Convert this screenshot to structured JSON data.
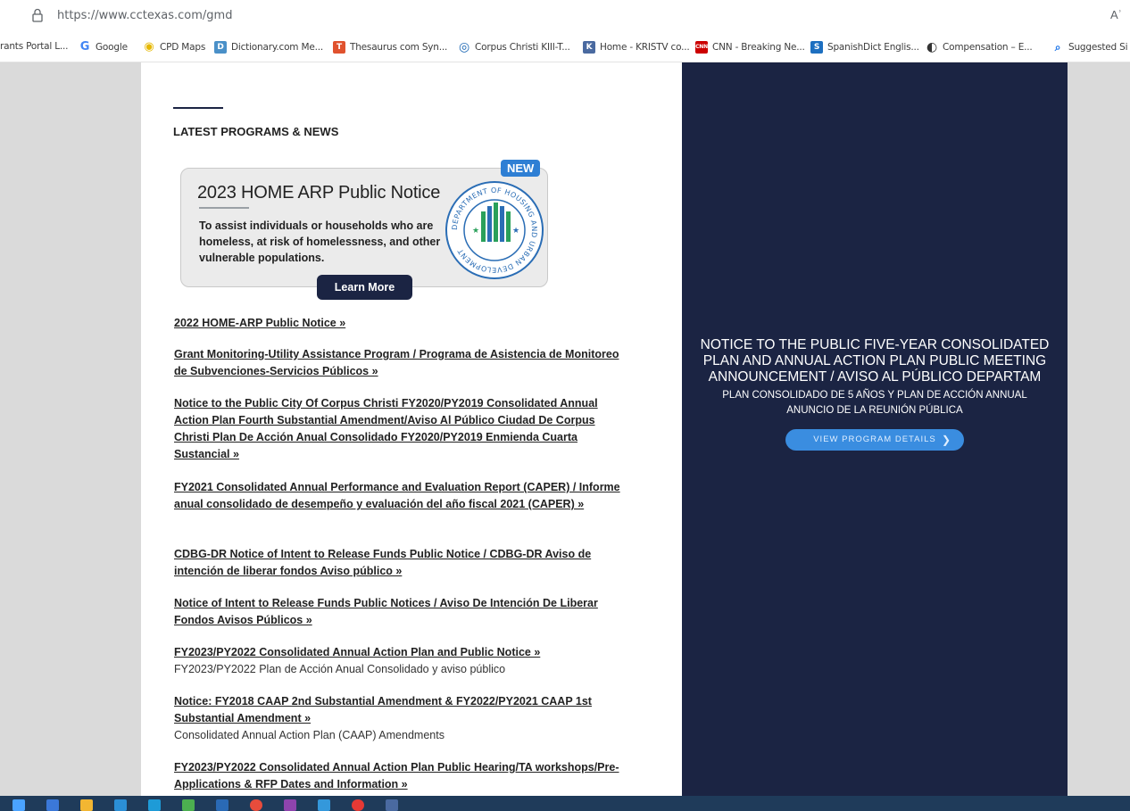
{
  "browser": {
    "url": "https://www.cctexas.com/gmd",
    "reader_icon": "Aʾ"
  },
  "bookmarks": [
    {
      "label": "rants Portal L...",
      "icon": "",
      "color": ""
    },
    {
      "label": "Google",
      "icon": "G",
      "color": "#4285f4"
    },
    {
      "label": "CPD Maps",
      "icon": "◉",
      "color": "#e6b800"
    },
    {
      "label": "Dictionary.com Me...",
      "icon": "D",
      "color": "#4a90c8"
    },
    {
      "label": "Thesaurus com Syn...",
      "icon": "T",
      "color": "#e0522e"
    },
    {
      "label": "Corpus Christi KIII-T...",
      "icon": "◎",
      "color": "#1a66b3"
    },
    {
      "label": "Home - KRISTV co...",
      "icon": "K",
      "color": "#4a6aa0"
    },
    {
      "label": "CNN - Breaking Ne...",
      "icon": "CNN",
      "color": "#cc0000"
    },
    {
      "label": "SpanishDict Englis...",
      "icon": "S",
      "color": "#1d6fc0"
    },
    {
      "label": "Compensation – E...",
      "icon": "◐",
      "color": "#333333"
    },
    {
      "label": "Suggested Si",
      "icon": "⌕",
      "color": "#1a73e8"
    }
  ],
  "section": {
    "title": "LATEST PROGRAMS & NEWS"
  },
  "card": {
    "badge": "NEW",
    "title": "2023 HOME ARP Public Notice",
    "description": "To assist individuals or households who are homeless, at risk of homelessness, and other vulnerable populations.",
    "button": "Learn More"
  },
  "news": [
    {
      "link": "2022 HOME-ARP Public Notice »",
      "sub": ""
    },
    {
      "link": "Grant Monitoring-Utility Assistance Program / Programa de Asistencia de Monitoreo de Subvenciones-Servicios Públicos »",
      "sub": ""
    },
    {
      "link": "Notice to the Public City Of Corpus Christi FY2020/PY2019 Consolidated Annual Action Plan Fourth Substantial Amendment/Aviso Al Público Ciudad De Corpus Christi Plan De Acción Anual Consolidado FY2020/PY2019 Enmienda Cuarta Sustancial »",
      "sub": ""
    },
    {
      "link": "FY2021 Consolidated Annual Performance and Evaluation Report (CAPER) / Informe anual consolidado de desempeño y evaluación del año fiscal 2021 (CAPER) »",
      "sub": ""
    },
    {
      "link": "CDBG-DR Notice of Intent to Release Funds Public Notice / CDBG-DR Aviso de intención de liberar fondos Aviso público »",
      "sub": ""
    },
    {
      "link": "Notice of Intent to Release Funds Public Notices / Aviso De Intención De Liberar Fondos Avisos Públicos »",
      "sub": ""
    },
    {
      "link": "FY2023/PY2022 Consolidated Annual Action Plan and Public Notice »",
      "sub": "FY2023/PY2022 Plan de Acción Anual Consolidado y aviso público"
    },
    {
      "link": "Notice: FY2018 CAAP 2nd Substantial Amendment & FY2022/PY2021 CAAP 1st Substantial Amendment »",
      "sub": "Consolidated Annual Action Plan (CAAP) Amendments"
    },
    {
      "link": "FY2023/PY2022 Consolidated Annual Action Plan Public Hearing/TA workshops/Pre-Applications & RFP Dates and Information »",
      "sub": ""
    }
  ],
  "hero": {
    "headline": "NOTICE TO THE PUBLIC FIVE-YEAR CONSOLIDATED PLAN AND ANNUAL ACTION PLAN PUBLIC MEETING ANNOUNCEMENT / AVISO AL PÚBLICO DEPARTAM",
    "subline": "PLAN CONSOLIDADO DE 5 AÑOS Y PLAN DE ACCIÓN ANNUAL ANUNCIO DE LA REUNIÓN PÚBLICA",
    "button": "VIEW PROGRAM DETAILS"
  },
  "colors": {
    "navy": "#1b2443",
    "accent_blue": "#3a8de0",
    "badge_blue": "#2e7fd4"
  },
  "seal": {
    "text": "DEPARTMENT OF HOUSING AND URBAN DEVELOPMENT"
  }
}
